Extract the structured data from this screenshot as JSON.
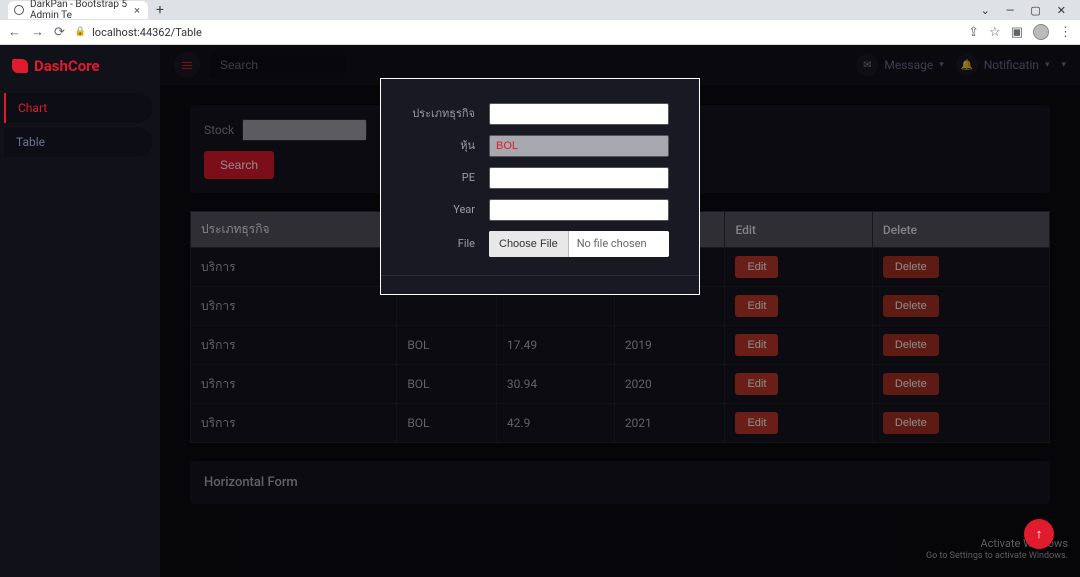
{
  "browser": {
    "tab_title": "DarkPan - Bootstrap 5 Admin Te",
    "url": "localhost:44362/Table"
  },
  "brand": "DashCore",
  "sidebar": {
    "items": [
      {
        "label": "Chart",
        "active": true
      },
      {
        "label": "Table",
        "active": false
      }
    ]
  },
  "topbar": {
    "search_placeholder": "Search",
    "message": "Message",
    "notification": "Notificatin"
  },
  "filter": {
    "stock_label": "Stock",
    "search_btn": "Search"
  },
  "table": {
    "headers": [
      "ประเภทธุรกิจ",
      "",
      "",
      "",
      "Edit",
      "Delete"
    ],
    "rows": [
      {
        "c0": "บริการ",
        "c1": "",
        "c2": "",
        "c3": "",
        "edit": "Edit",
        "del": "Delete"
      },
      {
        "c0": "บริการ",
        "c1": "",
        "c2": "",
        "c3": "",
        "edit": "Edit",
        "del": "Delete"
      },
      {
        "c0": "บริการ",
        "c1": "BOL",
        "c2": "17.49",
        "c3": "2019",
        "edit": "Edit",
        "del": "Delete"
      },
      {
        "c0": "บริการ",
        "c1": "BOL",
        "c2": "30.94",
        "c3": "2020",
        "edit": "Edit",
        "del": "Delete"
      },
      {
        "c0": "บริการ",
        "c1": "BOL",
        "c2": "42.9",
        "c3": "2021",
        "edit": "Edit",
        "del": "Delete"
      }
    ]
  },
  "modal": {
    "fields": {
      "type_label": "ประเภทธุรกิจ",
      "stock_label": "หุ้น",
      "stock_value": "BOL",
      "pe_label": "PE",
      "year_label": "Year",
      "file_label": "File",
      "choose_file": "Choose File",
      "no_file": "No file chosen"
    }
  },
  "section": {
    "horizontal_form": "Horizontal Form"
  },
  "watermark": {
    "title": "Activate Windows",
    "sub": "Go to Settings to activate Windows."
  }
}
